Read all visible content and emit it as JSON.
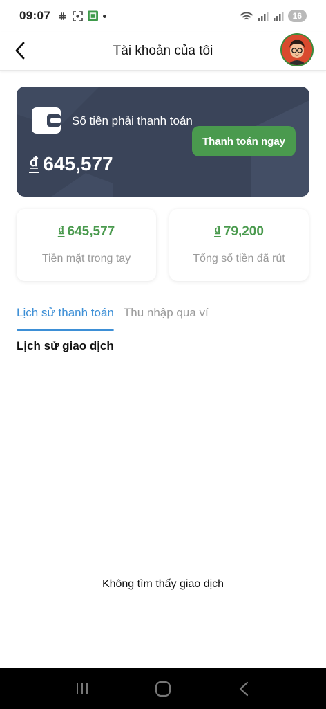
{
  "status_bar": {
    "time": "09:07",
    "battery": "16",
    "icons": [
      "slack-icon",
      "screenshot-icon",
      "app-icon",
      "wifi-icon",
      "signal-icon",
      "signal-icon"
    ]
  },
  "app_bar": {
    "title": "Tài khoản của tôi",
    "back_icon": "back-icon",
    "avatar": "avatar"
  },
  "balance_card": {
    "label": "Số tiền phải thanh toán",
    "currency": "₫",
    "amount": "645,577",
    "pay_button": "Thanh toán ngay",
    "colors": {
      "card_bg": "#3a4459",
      "button_bg": "#4a9a4e"
    }
  },
  "stats": [
    {
      "currency": "₫",
      "value": "645,577",
      "label": "Tiền mặt trong tay"
    },
    {
      "currency": "₫",
      "value": "79,200",
      "label": "Tổng số tiền đã rút"
    }
  ],
  "tabs": [
    {
      "label": "Lịch sử thanh toán",
      "active": true
    },
    {
      "label": "Thu nhập qua ví",
      "active": false
    }
  ],
  "section_title": "Lịch sử giao dịch",
  "empty_message": "Không tìm thấy giao dịch",
  "colors": {
    "accent_green": "#4a9a4e",
    "accent_blue": "#3d8fd6"
  }
}
